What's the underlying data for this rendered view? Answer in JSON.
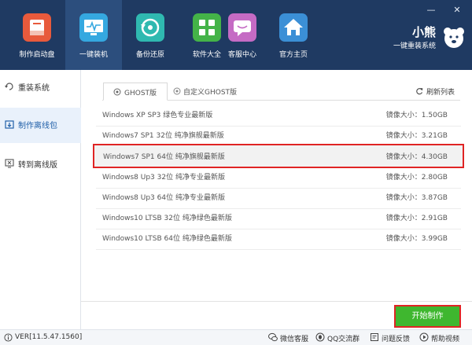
{
  "window": {
    "minimize": "—",
    "close": "✕"
  },
  "nav": [
    {
      "label": "制作启动盘",
      "icon": "usb-drive-icon",
      "color": "#e85a3c"
    },
    {
      "label": "一键装机",
      "icon": "monitor-icon",
      "color": "#35a8e0",
      "active": true
    },
    {
      "label": "备份还原",
      "icon": "restore-icon",
      "color": "#2fb9b0"
    },
    {
      "label": "软件大全",
      "icon": "apps-icon",
      "color": "#44b348"
    },
    {
      "label": "客服中心",
      "icon": "chat-icon",
      "color": "#c56bc4"
    },
    {
      "label": "官方主页",
      "icon": "home-icon",
      "color": "#3b8fd6"
    }
  ],
  "brand": {
    "name": "小熊",
    "subtitle": "一键重装系统"
  },
  "sidebar": [
    {
      "label": "重装系统",
      "icon": "reinstall-icon"
    },
    {
      "label": "制作离线包",
      "icon": "offline-package-icon",
      "active": true
    },
    {
      "label": "转到离线版",
      "icon": "offline-version-icon"
    }
  ],
  "tabs": [
    {
      "label": "GHOST版",
      "icon": "ghost-icon",
      "active": true
    },
    {
      "label": "自定义GHOST版",
      "icon": "custom-ghost-icon"
    }
  ],
  "refresh_label": "刷新列表",
  "images": [
    {
      "name": "Windows XP SP3 绿色专业最新版",
      "size": "镜像大小：1.50GB"
    },
    {
      "name": "Windows7 SP1 32位 纯净旗舰最新版",
      "size": "镜像大小：3.21GB"
    },
    {
      "name": "Windows7 SP1 64位 纯净旗舰最新版",
      "size": "镜像大小：4.30GB",
      "selected": true
    },
    {
      "name": "Windows8 Up3 32位 纯净专业最新版",
      "size": "镜像大小：2.80GB"
    },
    {
      "name": "Windows8 Up3 64位 纯净专业最新版",
      "size": "镜像大小：3.87GB"
    },
    {
      "name": "Windows10 LTSB 32位 纯净绿色最新版",
      "size": "镜像大小：2.91GB"
    },
    {
      "name": "Windows10 LTSB 64位 纯净绿色最新版",
      "size": "镜像大小：3.99GB"
    }
  ],
  "start_button": "开始制作",
  "status": {
    "version": "VER[11.5.47.1560]",
    "wechat": "微信客服",
    "qq": "QQ交流群",
    "feedback": "问题反馈",
    "help": "帮助视频"
  },
  "colors": {
    "header": "#1f3a62",
    "accent_green": "#3fb72f",
    "highlight_red": "#e02424"
  }
}
